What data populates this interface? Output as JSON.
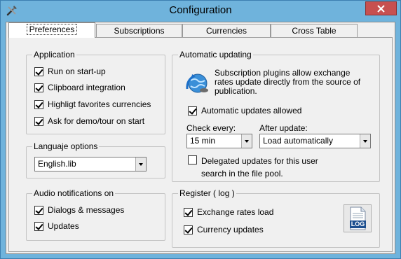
{
  "window": {
    "title": "Configuration"
  },
  "tabs": [
    {
      "label": "Preferences",
      "active": true
    },
    {
      "label": "Subscriptions",
      "active": false
    },
    {
      "label": "Currencies",
      "active": false
    },
    {
      "label": "Cross Table",
      "active": false
    }
  ],
  "application": {
    "title": "Application",
    "options": [
      {
        "label": "Run on start-up",
        "checked": true
      },
      {
        "label": "Clipboard integration",
        "checked": true
      },
      {
        "label": "Highligt favorites currencies",
        "checked": true
      },
      {
        "label": "Ask for demo/tour on start",
        "checked": true
      }
    ]
  },
  "language": {
    "title": "Languaje options",
    "selected": "English.lib"
  },
  "audio": {
    "title": "Audio notifications on",
    "options": [
      {
        "label": "Dialogs & messages",
        "checked": true
      },
      {
        "label": "Updates",
        "checked": true
      }
    ]
  },
  "auto_update": {
    "title": "Automatic updating",
    "description": "Subscription plugins allow exchange rates update directly from the source of publication.",
    "allowed_label": "Automatic updates allowed",
    "allowed_checked": true,
    "check_every_label": "Check every:",
    "check_every_value": "15 min",
    "after_update_label": "After update:",
    "after_update_value": "Load automatically",
    "delegated_label": "Delegated updates for this user search in the file pool.",
    "delegated_checked": false
  },
  "register": {
    "title": "Register ( log )",
    "options": [
      {
        "label": "Exchange rates load",
        "checked": true
      },
      {
        "label": "Currency updates",
        "checked": true
      }
    ],
    "log_button_label": "LOG"
  },
  "colors": {
    "titlebar": "#6fb3dc",
    "close_button": "#c75050",
    "panel": "#f0f0f0"
  }
}
